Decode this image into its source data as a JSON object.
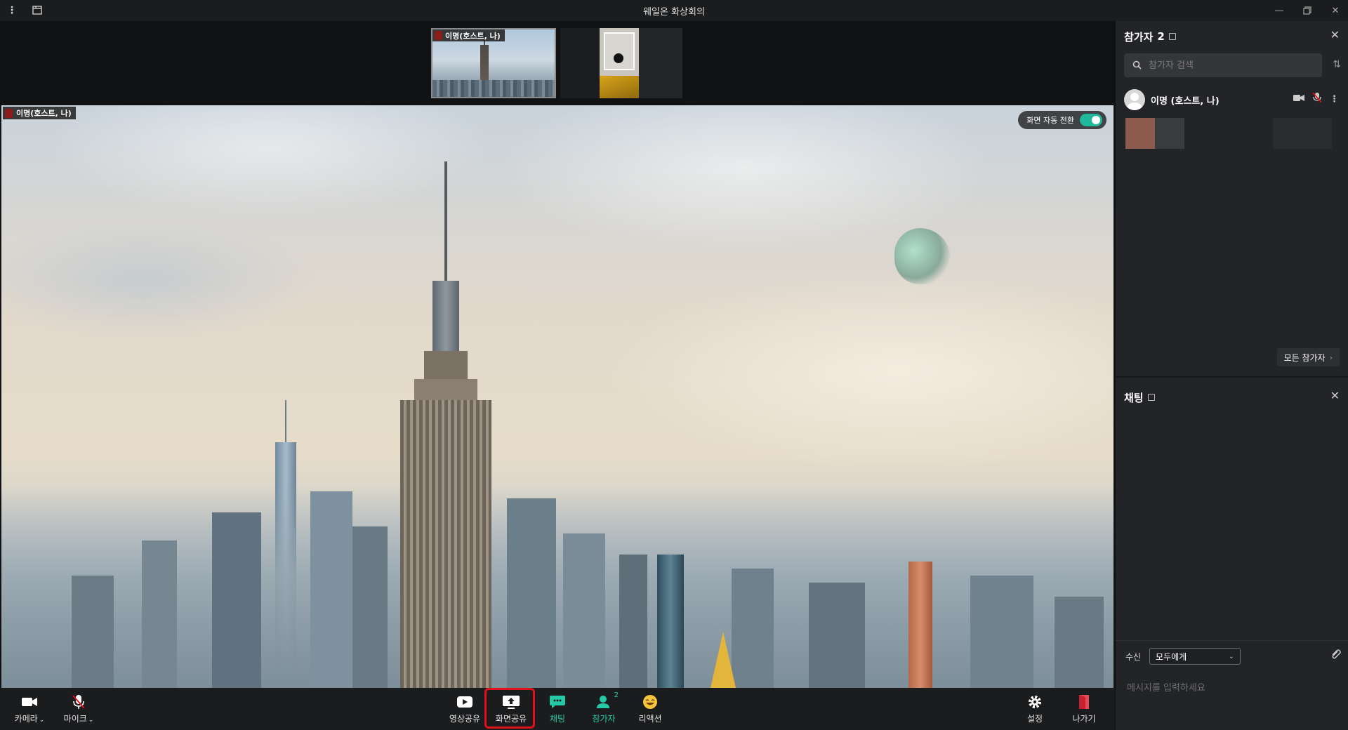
{
  "window": {
    "title": "웨일온 화상회의",
    "menu_icon": "vertical-dots-icon",
    "layout_icon": "window-layout-icon",
    "controls": [
      "minimize",
      "restore",
      "close"
    ]
  },
  "stage": {
    "thumbnails": [
      {
        "label": "이명(호스트, 나)",
        "selected": true
      },
      {
        "label": ""
      }
    ],
    "main_label": "이명(호스트, 나)",
    "auto_switch": {
      "label": "화면 자동 전환",
      "enabled": true
    }
  },
  "toolbar": {
    "camera": "카메라",
    "mic": "마이크",
    "video_share": "영상공유",
    "screen_share": "화면공유",
    "chat": "채팅",
    "participants": "참가자",
    "participants_badge": "2",
    "reaction": "리액션",
    "settings": "설정",
    "leave": "나가기",
    "accent_color": "#26c9a5",
    "highlight_color": "#e0111b"
  },
  "participants_panel": {
    "title": "참가자",
    "count": "2",
    "search_placeholder": "참가자 검색",
    "items": [
      {
        "name": "이명 (호스트, 나)",
        "camera": "on",
        "mic": "muted"
      }
    ],
    "all_button": "모든 참가자"
  },
  "chat_panel": {
    "title": "채팅",
    "receiver_label": "수신",
    "receiver_value": "모두에게",
    "message_placeholder": "메시지를 입력하세요"
  }
}
